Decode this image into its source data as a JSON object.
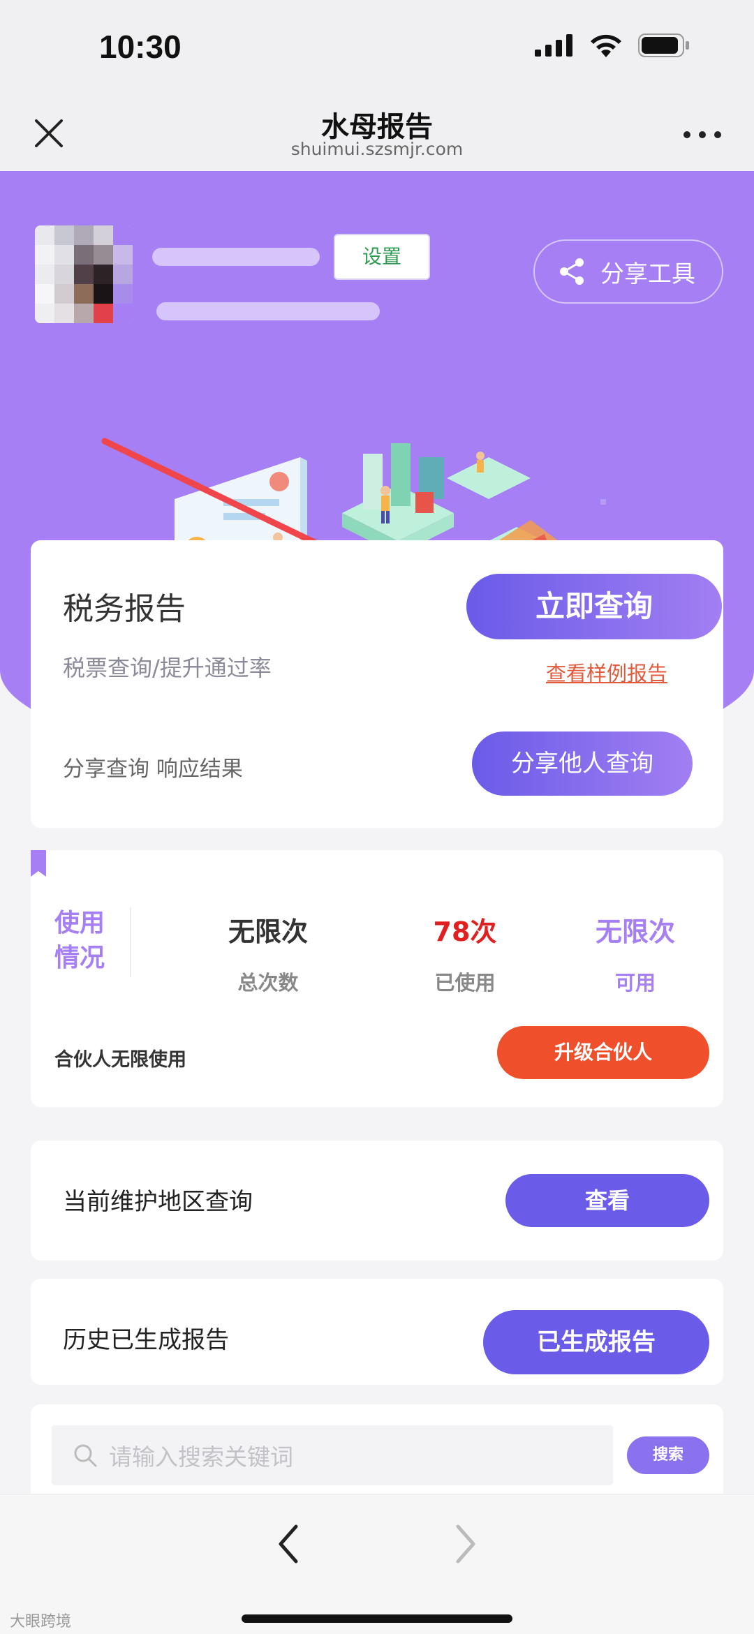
{
  "status_bar": {
    "time": "10:30"
  },
  "nav": {
    "title": "水母报告",
    "url": "shuimui.szsmjr.com"
  },
  "header": {
    "settings_label": "设置",
    "share_tool_label": "分享工具"
  },
  "report": {
    "title": "税务报告",
    "subtitle": "税票查询/提升通过率",
    "query_now_label": "立即查询",
    "sample_link_label": "查看样例报告",
    "share_query_text": "分享查询 响应结果",
    "share_others_label": "分享他人查询"
  },
  "usage": {
    "label_line1": "使用",
    "label_line2": "情况",
    "stats": [
      {
        "value": "无限次",
        "label": "总次数",
        "color": "#333333"
      },
      {
        "value": "78次",
        "label": "已使用",
        "color": "#e02020"
      },
      {
        "value": "无限次",
        "label": "可用",
        "color": "#a57ff3"
      }
    ],
    "partner_text": "合伙人无限使用",
    "upgrade_label": "升级合伙人"
  },
  "region": {
    "text": "当前维护地区查询",
    "button_label": "查看"
  },
  "history": {
    "text": "历史已生成报告",
    "button_label": "已生成报告"
  },
  "search": {
    "placeholder": "请输入搜索关键词",
    "button_label": "搜索"
  },
  "watermark": "大眼跨境",
  "colors": {
    "hero_purple": "#a57ff3",
    "primary_button": "#6a5be8",
    "upgrade_orange": "#f04f2c",
    "link_red": "#e05a3b"
  }
}
